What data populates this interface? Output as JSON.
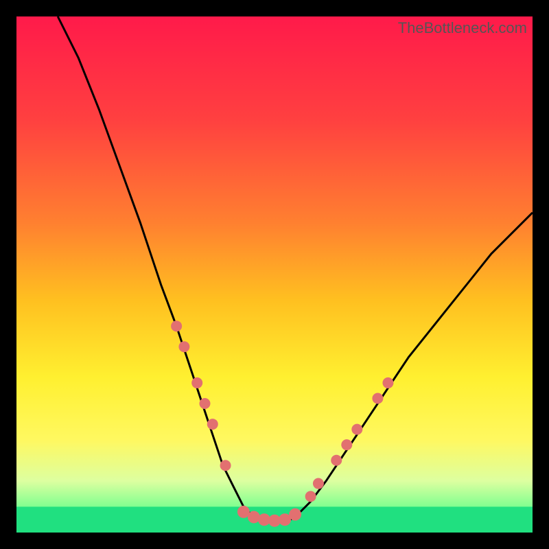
{
  "watermark": "TheBottleneck.com",
  "chart_data": {
    "type": "line",
    "title": "",
    "xlabel": "",
    "ylabel": "",
    "xlim": [
      0,
      100
    ],
    "ylim": [
      0,
      100
    ],
    "series": [
      {
        "name": "curve",
        "x": [
          8,
          12,
          16,
          20,
          24,
          28,
          31,
          34,
          37,
          40,
          42,
          44,
          46,
          48,
          50,
          52,
          54,
          57,
          60,
          64,
          68,
          72,
          76,
          80,
          84,
          88,
          92,
          96,
          100
        ],
        "y": [
          100,
          92,
          82,
          71,
          60,
          48,
          40,
          31,
          22,
          13,
          9,
          5,
          3,
          2,
          2,
          2,
          3,
          6,
          10,
          16,
          22,
          28,
          34,
          39,
          44,
          49,
          54,
          58,
          62
        ]
      }
    ],
    "gradient_stops": [
      {
        "offset": 0,
        "color": "#ff1a4a"
      },
      {
        "offset": 20,
        "color": "#ff4040"
      },
      {
        "offset": 40,
        "color": "#ff8030"
      },
      {
        "offset": 55,
        "color": "#ffc020"
      },
      {
        "offset": 70,
        "color": "#fff030"
      },
      {
        "offset": 82,
        "color": "#fff860"
      },
      {
        "offset": 90,
        "color": "#ddffa0"
      },
      {
        "offset": 95,
        "color": "#80ff90"
      },
      {
        "offset": 100,
        "color": "#20e080"
      }
    ],
    "green_band": {
      "top_pct": 95,
      "bottom_pct": 100
    },
    "dots": {
      "left": [
        {
          "x": 31,
          "y": 40
        },
        {
          "x": 32.5,
          "y": 36
        },
        {
          "x": 35,
          "y": 29
        },
        {
          "x": 36.5,
          "y": 25
        },
        {
          "x": 38,
          "y": 21
        },
        {
          "x": 40.5,
          "y": 13
        }
      ],
      "right": [
        {
          "x": 57,
          "y": 7
        },
        {
          "x": 58.5,
          "y": 9.5
        },
        {
          "x": 62,
          "y": 14
        },
        {
          "x": 64,
          "y": 17
        },
        {
          "x": 66,
          "y": 20
        },
        {
          "x": 70,
          "y": 26
        },
        {
          "x": 72,
          "y": 29
        }
      ],
      "bottom": [
        {
          "x": 44,
          "y": 4
        },
        {
          "x": 46,
          "y": 3
        },
        {
          "x": 48,
          "y": 2.5
        },
        {
          "x": 50,
          "y": 2.3
        },
        {
          "x": 52,
          "y": 2.5
        },
        {
          "x": 54,
          "y": 3.5
        }
      ]
    }
  }
}
